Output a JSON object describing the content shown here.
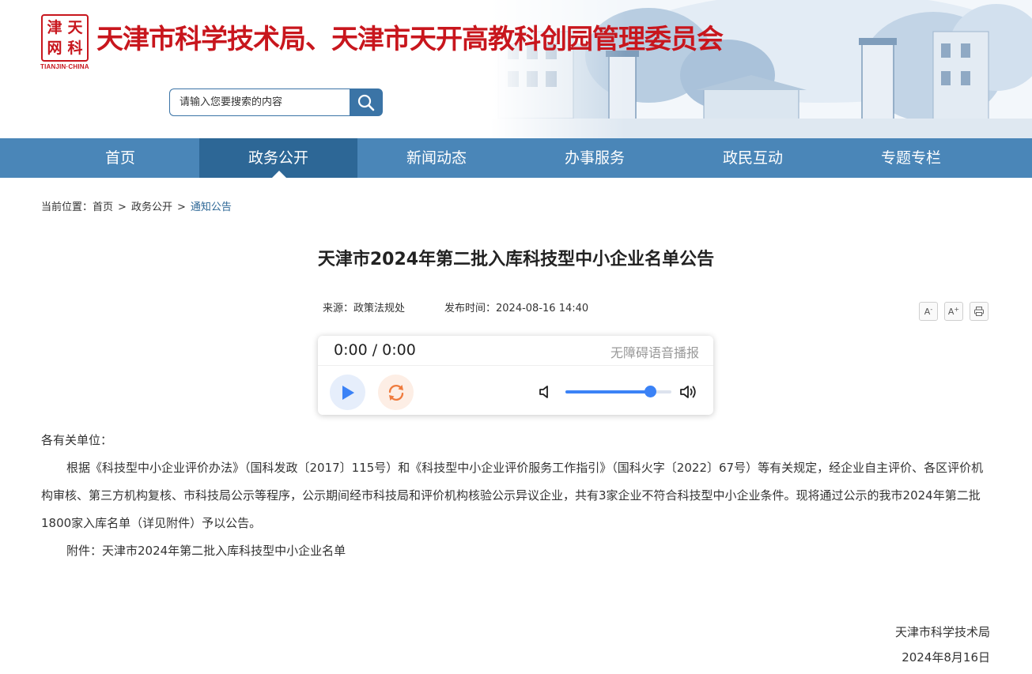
{
  "header": {
    "logo_chars": [
      "天",
      "津",
      "科",
      "网"
    ],
    "logo_sub": "TIANJIN·CHINA",
    "title": "天津市科学技术局、天津市天开高教科创园管理委员会",
    "brand_color": "#c8161d"
  },
  "search": {
    "placeholder": "请输入您要搜索的内容",
    "icon": "search-icon"
  },
  "nav": {
    "items": [
      {
        "label": "首页"
      },
      {
        "label": "政务公开"
      },
      {
        "label": "新闻动态"
      },
      {
        "label": "办事服务"
      },
      {
        "label": "政民互动"
      },
      {
        "label": "专题专栏"
      }
    ],
    "active_index": 1,
    "bar_color": "#4a86b8",
    "active_color": "#2d6796"
  },
  "breadcrumb": {
    "prefix": "当前位置：",
    "items": [
      "首页",
      "政务公开",
      "通知公告"
    ],
    "separator": ">"
  },
  "article": {
    "title": "天津市2024年第二批入库科技型中小企业名单公告",
    "source": "来源：政策法规处",
    "publish_time": "发布时间：2024-08-16 14:40",
    "tools": {
      "font_smaller": "A",
      "font_larger": "A",
      "font_smaller_sup": "-",
      "font_larger_sup": "+",
      "print_icon": "print-icon"
    }
  },
  "player": {
    "time": "0:00 / 0:00",
    "label": "无障碍语音播报",
    "volume_fraction": 0.8,
    "accent_color": "#3b82f6"
  },
  "content": {
    "salutation": "各有关单位：",
    "paragraph": "根据《科技型中小企业评价办法》（国科发政〔2017〕115号）和《科技型中小企业评价服务工作指引》（国科火字〔2022〕67号）等有关规定，经企业自主评价、各区评价机构审核、第三方机构复核、市科技局公示等程序，公示期间经市科技局和评价机构核验公示异议企业，共有3家企业不符合科技型中小企业条件。现将通过公示的我市2024年第二批1800家入库名单（详见附件）予以公告。",
    "attachment": "附件：天津市2024年第二批入库科技型中小企业名单",
    "signer": "天津市科学技术局",
    "date": "2024年8月16日"
  }
}
